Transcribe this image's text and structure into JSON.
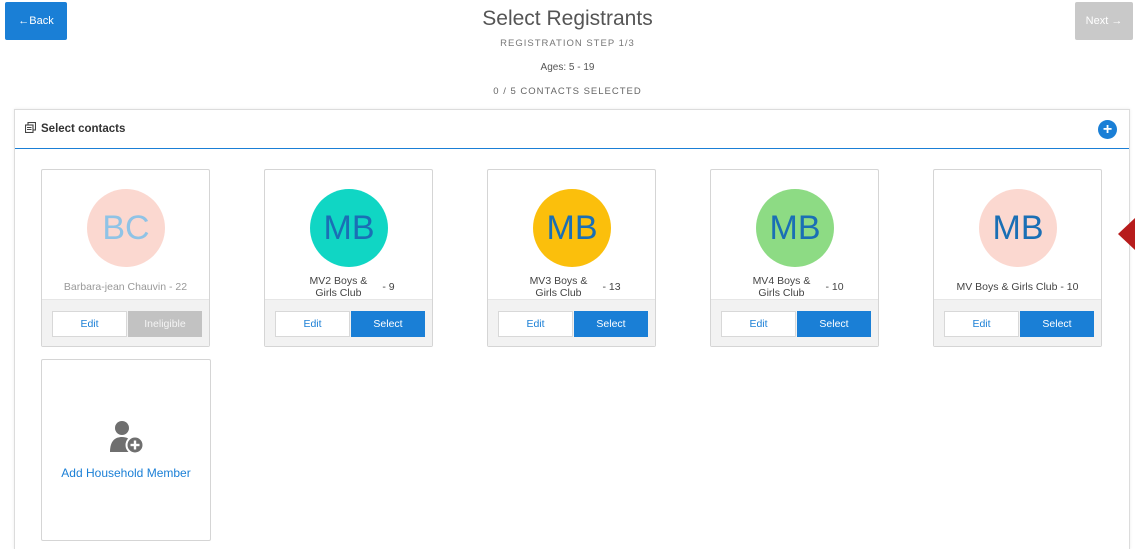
{
  "nav": {
    "back_label": "←Back",
    "next_label": "Next →"
  },
  "header": {
    "title": "Select Registrants",
    "step": "REGISTRATION STEP 1/3",
    "ages": "Ages: 5 - 19",
    "selected_count": "0 / 5 CONTACTS SELECTED"
  },
  "panel": {
    "title": "Select contacts",
    "add_icon": "plus-circle-icon",
    "header_icon": "contacts-icon"
  },
  "contacts": [
    {
      "initials": "BC",
      "name": "Barbara-jean Chauvin - 22",
      "age": "",
      "avatar_bg": "#fbd8d0",
      "initials_color": "#8fc3e6",
      "edit_label": "Edit",
      "action_label": "Ineligible",
      "eligible": false
    },
    {
      "initials": "MB",
      "name": "MV2 Boys & Girls Club",
      "age": "- 9",
      "avatar_bg": "#10d6c4",
      "initials_color": "#1a6fb5",
      "edit_label": "Edit",
      "action_label": "Select",
      "eligible": true
    },
    {
      "initials": "MB",
      "name": "MV3 Boys & Girls Club",
      "age": "- 13",
      "avatar_bg": "#fbbf0c",
      "initials_color": "#1a6fb5",
      "edit_label": "Edit",
      "action_label": "Select",
      "eligible": true
    },
    {
      "initials": "MB",
      "name": "MV4 Boys & Girls Club",
      "age": "- 10",
      "avatar_bg": "#8ddb84",
      "initials_color": "#1a6fb5",
      "edit_label": "Edit",
      "action_label": "Select",
      "eligible": true
    },
    {
      "initials": "MB",
      "name": "MV Boys & Girls Club - 10",
      "age": "",
      "avatar_bg": "#fbd8d0",
      "initials_color": "#1a6fb5",
      "edit_label": "Edit",
      "action_label": "Select",
      "eligible": true
    }
  ],
  "add_member": {
    "label": "Add Household Member",
    "icon": "add-person-icon"
  },
  "colors": {
    "primary": "#1a7fd6",
    "disabled": "#c2c2c2",
    "marker": "#b71c1c"
  }
}
